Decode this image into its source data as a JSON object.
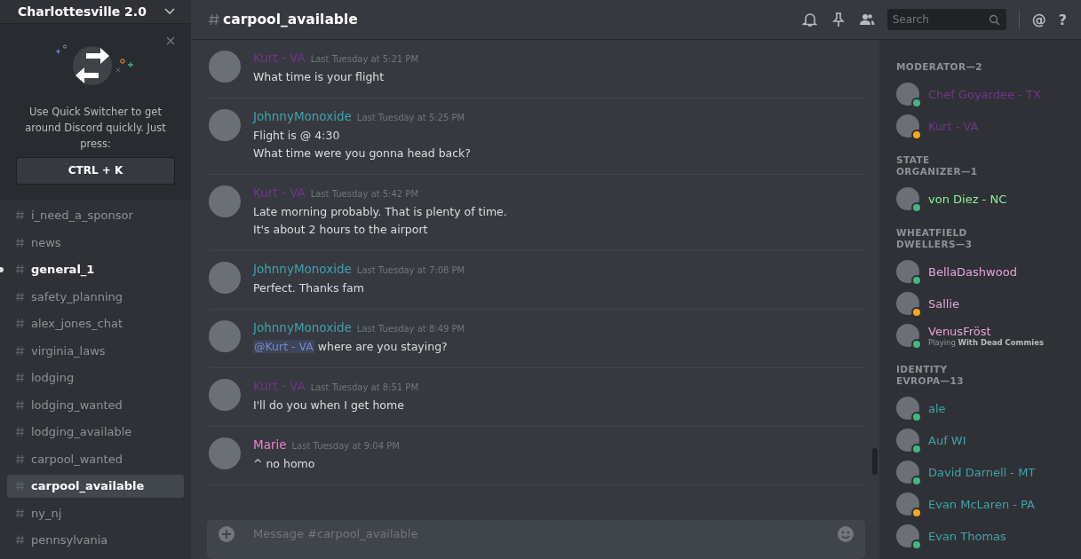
{
  "server": {
    "name": "Charlottesville 2.0"
  },
  "quick_switcher": {
    "text": "Use Quick Switcher to get around Discord quickly. Just press:",
    "shortcut": "CTRL + K"
  },
  "channels": [
    {
      "name": "i_need_a_sponsor",
      "selected": false,
      "unread": false
    },
    {
      "name": "news",
      "selected": false,
      "unread": false
    },
    {
      "name": "general_1",
      "selected": false,
      "unread": true
    },
    {
      "name": "safety_planning",
      "selected": false,
      "unread": false
    },
    {
      "name": "alex_jones_chat",
      "selected": false,
      "unread": false
    },
    {
      "name": "virginia_laws",
      "selected": false,
      "unread": false
    },
    {
      "name": "lodging",
      "selected": false,
      "unread": false
    },
    {
      "name": "lodging_wanted",
      "selected": false,
      "unread": false
    },
    {
      "name": "lodging_available",
      "selected": false,
      "unread": false
    },
    {
      "name": "carpool_wanted",
      "selected": false,
      "unread": false
    },
    {
      "name": "carpool_available",
      "selected": true,
      "unread": false
    },
    {
      "name": "ny_nj",
      "selected": false,
      "unread": false
    },
    {
      "name": "pennsylvania",
      "selected": false,
      "unread": false
    }
  ],
  "header": {
    "channel": "carpool_available",
    "search_placeholder": "Search",
    "mention_icon": "@",
    "help_icon": "?"
  },
  "messages": [
    {
      "author": "Kurt - VA",
      "color": "#71368a",
      "time": "Last Tuesday at 5:21 PM",
      "lines": [
        "What time is your flight"
      ]
    },
    {
      "author": "JohnnyMonoxide",
      "color": "#3ea3ad",
      "time": "Last Tuesday at 5:25 PM",
      "lines": [
        "Flight is @ 4:30",
        "What time were you gonna head back?"
      ]
    },
    {
      "author": "Kurt - VA",
      "color": "#71368a",
      "time": "Last Tuesday at 5:42 PM",
      "lines": [
        "Late morning probably. That is plenty of time.",
        "It's about 2 hours to the airport"
      ]
    },
    {
      "author": "JohnnyMonoxide",
      "color": "#3ea3ad",
      "time": "Last Tuesday at 7:08 PM",
      "lines": [
        "Perfect. Thanks fam"
      ]
    },
    {
      "author": "JohnnyMonoxide",
      "color": "#3ea3ad",
      "time": "Last Tuesday at 8:49 PM",
      "mention": "@Kurt - VA",
      "lines": [
        "where are you staying?"
      ]
    },
    {
      "author": "Kurt - VA",
      "color": "#71368a",
      "time": "Last Tuesday at 8:51 PM",
      "lines": [
        "I'll do you when I get home"
      ]
    },
    {
      "author": "Marie",
      "color": "#f47fd0",
      "time": "Last Tuesday at 9:04 PM",
      "lines": [
        "^ no homo"
      ]
    }
  ],
  "composer": {
    "placeholder": "Message #carpool_available"
  },
  "member_groups": [
    {
      "title": "MODERATOR—2",
      "members": [
        {
          "name": "Chef Goyardee - TX",
          "color": "#71368a",
          "idle": false
        },
        {
          "name": "Kurt - VA",
          "color": "#71368a",
          "idle": true
        }
      ]
    },
    {
      "title": "STATE ORGANIZER—1",
      "members": [
        {
          "name": "von Diez - NC",
          "color": "#8af29a",
          "idle": false
        }
      ]
    },
    {
      "title": "WHEATFIELD DWELLERS—3",
      "members": [
        {
          "name": "BellaDashwood",
          "color": "#e9a4d6",
          "idle": false
        },
        {
          "name": "Sallie",
          "color": "#e9a4d6",
          "idle": true
        },
        {
          "name": "VenusFröst",
          "color": "#e9a4d6",
          "idle": false,
          "activity": "Playing **With Dead Commies**"
        }
      ]
    },
    {
      "title": "IDENTITY EVROPA—13",
      "members": [
        {
          "name": "ale",
          "color": "#3ea3ad",
          "idle": false
        },
        {
          "name": "Auf WI",
          "color": "#3ea3ad",
          "idle": false
        },
        {
          "name": "David Darnell - MT",
          "color": "#3ea3ad",
          "idle": false
        },
        {
          "name": "Evan McLaren - PA",
          "color": "#3ea3ad",
          "idle": true
        },
        {
          "name": "Evan Thomas",
          "color": "#3ea3ad",
          "idle": false
        }
      ]
    }
  ]
}
